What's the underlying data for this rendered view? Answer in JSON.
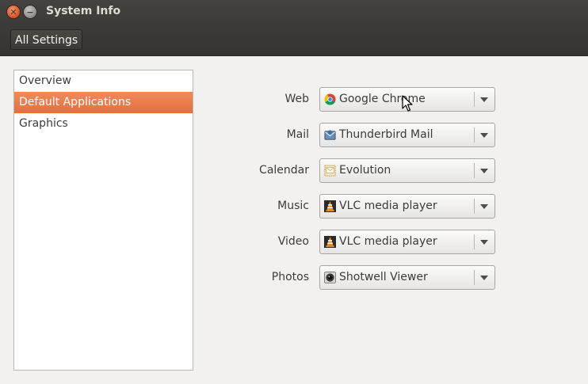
{
  "window": {
    "title": "System Info"
  },
  "toolbar": {
    "all_settings_label": "All Settings"
  },
  "sidebar": {
    "items": [
      {
        "label": "Overview",
        "selected": false
      },
      {
        "label": "Default Applications",
        "selected": true
      },
      {
        "label": "Graphics",
        "selected": false
      }
    ]
  },
  "defaults": [
    {
      "label": "Web",
      "value": "Google Chrome",
      "icon": "chrome-icon"
    },
    {
      "label": "Mail",
      "value": "Thunderbird Mail",
      "icon": "thunderbird-icon"
    },
    {
      "label": "Calendar",
      "value": "Evolution",
      "icon": "evolution-icon"
    },
    {
      "label": "Music",
      "value": "VLC media player",
      "icon": "vlc-icon"
    },
    {
      "label": "Video",
      "value": "VLC media player",
      "icon": "vlc-icon"
    },
    {
      "label": "Photos",
      "value": "Shotwell Viewer",
      "icon": "shotwell-icon"
    }
  ],
  "colors": {
    "selection": "#e8743f",
    "titlebar": "#3c3b37"
  }
}
